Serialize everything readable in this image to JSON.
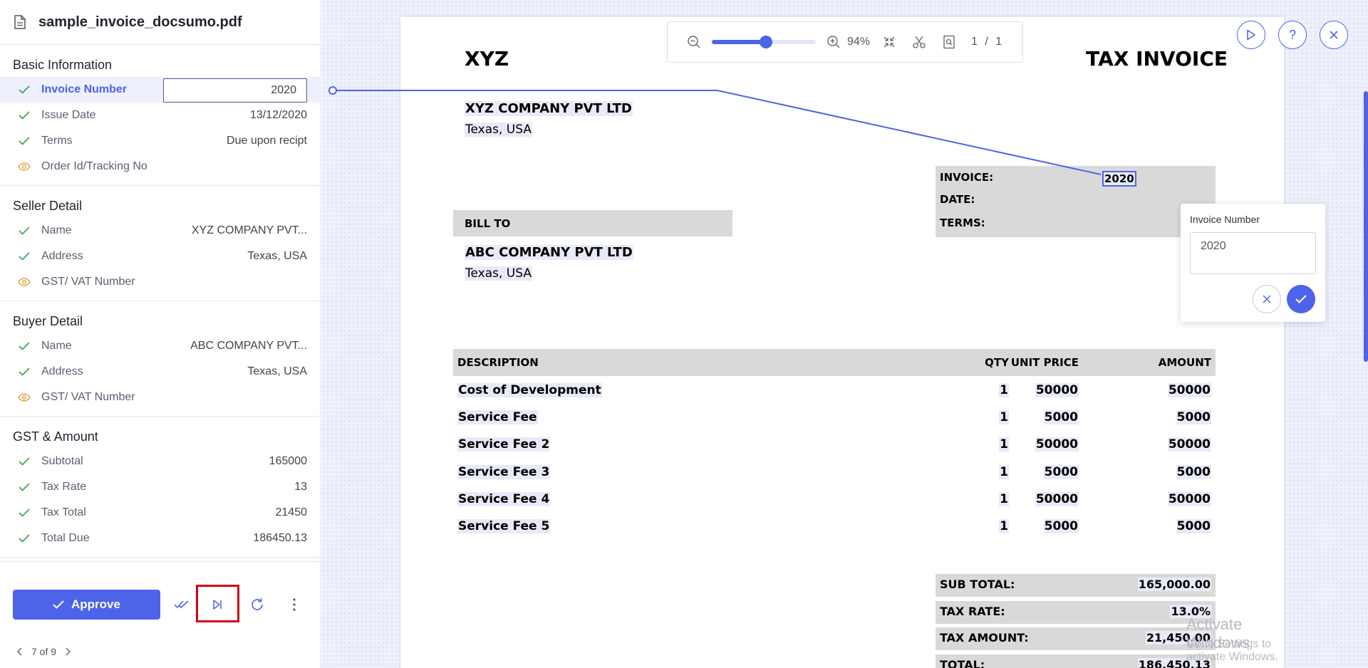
{
  "file": {
    "name": "sample_invoice_docsumo.pdf"
  },
  "sections": [
    {
      "title": "Basic Information",
      "fields": [
        {
          "label": "Invoice Number",
          "value": "2020",
          "status": "check",
          "editing": true
        },
        {
          "label": "Issue Date",
          "value": "13/12/2020",
          "status": "check"
        },
        {
          "label": "Terms",
          "value": "Due upon recipt",
          "status": "check"
        },
        {
          "label": "Order Id/Tracking No",
          "value": "",
          "status": "eye"
        }
      ]
    },
    {
      "title": "Seller Detail",
      "fields": [
        {
          "label": "Name",
          "value": "XYZ COMPANY PVT...",
          "status": "check"
        },
        {
          "label": "Address",
          "value": "Texas, USA",
          "status": "check"
        },
        {
          "label": "GST/ VAT Number",
          "value": "",
          "status": "eye"
        }
      ]
    },
    {
      "title": "Buyer Detail",
      "fields": [
        {
          "label": "Name",
          "value": "ABC COMPANY PVT...",
          "status": "check"
        },
        {
          "label": "Address",
          "value": "Texas, USA",
          "status": "check"
        },
        {
          "label": "GST/ VAT Number",
          "value": "",
          "status": "eye"
        }
      ]
    },
    {
      "title": "GST & Amount",
      "fields": [
        {
          "label": "Subtotal",
          "value": "165000",
          "status": "check"
        },
        {
          "label": "Tax Rate",
          "value": "13",
          "status": "check"
        },
        {
          "label": "Tax Total",
          "value": "21450",
          "status": "check"
        },
        {
          "label": "Total Due",
          "value": "186450.13",
          "status": "check"
        }
      ]
    }
  ],
  "footer": {
    "approve_label": "Approve",
    "pager_text": "7 of 9"
  },
  "toolbar": {
    "zoom": "94%",
    "zoom_level": 0.52,
    "page_indicator": "1 / 1"
  },
  "document": {
    "company_short": "XYZ",
    "doc_title": "TAX INVOICE",
    "seller_name": "XYZ COMPANY PVT LTD",
    "seller_address": "Texas, USA",
    "bill_to_label": "BILL TO",
    "buyer_name": "ABC COMPANY PVT LTD",
    "buyer_address": "Texas, USA",
    "invoice_label": "INVOICE:",
    "invoice_value": "2020",
    "date_label": "DATE:",
    "terms_label": "TERMS:",
    "items_header": {
      "description": "DESCRIPTION",
      "qty": "QTY",
      "unit_price": "UNIT PRICE",
      "amount": "AMOUNT"
    },
    "items": [
      {
        "description": "Cost of Development",
        "qty": "1",
        "unit_price": "50000",
        "amount": "50000"
      },
      {
        "description": "Service Fee",
        "qty": "1",
        "unit_price": "5000",
        "amount": "5000"
      },
      {
        "description": "Service Fee 2",
        "qty": "1",
        "unit_price": "50000",
        "amount": "50000"
      },
      {
        "description": "Service Fee 3",
        "qty": "1",
        "unit_price": "5000",
        "amount": "5000"
      },
      {
        "description": "Service Fee 4",
        "qty": "1",
        "unit_price": "50000",
        "amount": "50000"
      },
      {
        "description": "Service Fee 5",
        "qty": "1",
        "unit_price": "5000",
        "amount": "5000"
      }
    ],
    "totals": [
      {
        "label": "SUB TOTAL:",
        "value": "165,000.00"
      },
      {
        "label": "TAX RATE:",
        "value": "13.0%"
      },
      {
        "label": "TAX AMOUNT:",
        "value": "21,450.00"
      },
      {
        "label": "TOTAL:",
        "value": "186,450.13"
      }
    ]
  },
  "popover": {
    "title": "Invoice Number",
    "value": "2020"
  },
  "watermark": {
    "line1": "Activate Windows",
    "line2": "Go to Settings to activate Windows."
  },
  "colors": {
    "accent": "#4d63e8",
    "check": "#3ca45a",
    "eye": "#e6a23c",
    "highlight_border": "#d0021b"
  }
}
